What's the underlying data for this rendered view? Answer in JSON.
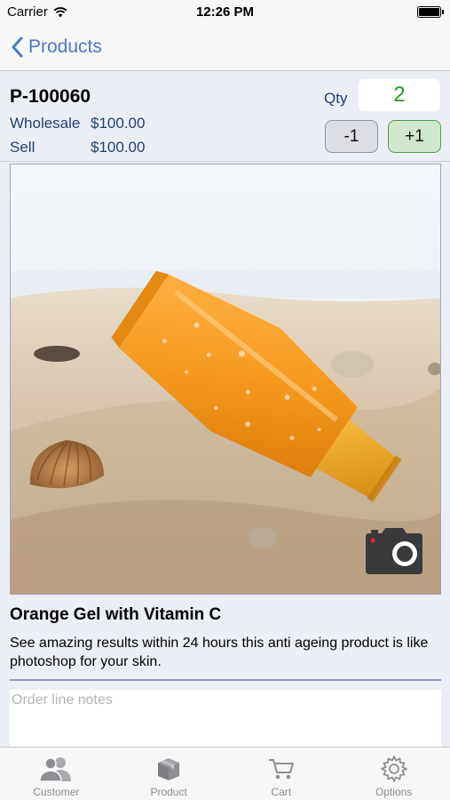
{
  "status_bar": {
    "carrier": "Carrier",
    "time": "12:26 PM"
  },
  "nav": {
    "back_label": "Products"
  },
  "product": {
    "code": "P-100060",
    "wholesale_label": "Wholesale",
    "wholesale_price": "$100.00",
    "sell_label": "Sell",
    "sell_price": "$100.00",
    "qty_label": "Qty",
    "qty_value": "2",
    "minus_label": "-1",
    "plus_label": "+1",
    "title": "Orange Gel with Vitamin C",
    "description": "See amazing results within 24 hours this anti ageing product is like photoshop for your skin."
  },
  "notes": {
    "placeholder": "Order line notes"
  },
  "tabs": [
    {
      "label": "Customer",
      "icon": "customer-icon"
    },
    {
      "label": "Product",
      "icon": "product-box-icon"
    },
    {
      "label": "Cart",
      "icon": "cart-icon"
    },
    {
      "label": "Options",
      "icon": "gear-icon"
    }
  ],
  "colors": {
    "accent_blue": "#4d79c1",
    "qty_green": "#1d9a2a",
    "label_navy": "#1f3f76"
  }
}
